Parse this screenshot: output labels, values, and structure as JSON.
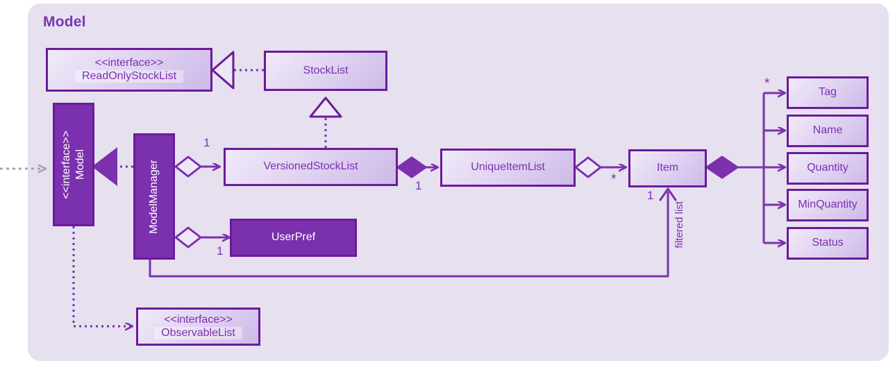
{
  "package": {
    "title": "Model",
    "background_color": "#e6e0ef",
    "accent_color": "#7b30ad",
    "border_color": "#6a1b9a"
  },
  "nodes": {
    "read_only_stock_list": {
      "stereotype": "<<interface>>",
      "name": "ReadOnlyStockList"
    },
    "stock_list": {
      "name": "StockList"
    },
    "model_iface": {
      "stereotype": "<<interface>>",
      "name": "Model"
    },
    "model_manager": {
      "name": "ModelManager"
    },
    "versioned_stock_list": {
      "name": "VersionedStockList"
    },
    "unique_item_list": {
      "name": "UniqueItemList"
    },
    "item": {
      "name": "Item"
    },
    "user_pref": {
      "name": "UserPref"
    },
    "observable_list": {
      "stereotype": "<<interface>>",
      "name": "ObservableList"
    },
    "tag": {
      "name": "Tag"
    },
    "name_attr": {
      "name": "Name"
    },
    "quantity": {
      "name": "Quantity"
    },
    "min_quantity": {
      "name": "MinQuantity"
    },
    "status": {
      "name": "Status"
    }
  },
  "multiplicities": {
    "modelmanager_to_versionedstocklist": "1",
    "versionedstocklist_to_uniqueitemlist": "1",
    "uniqueitemlist_to_item": "*",
    "modelmanager_to_userpref": "1",
    "item_to_tag": "*",
    "item_filtered": "1"
  },
  "edge_labels": {
    "filtered_list": "filtered list"
  }
}
